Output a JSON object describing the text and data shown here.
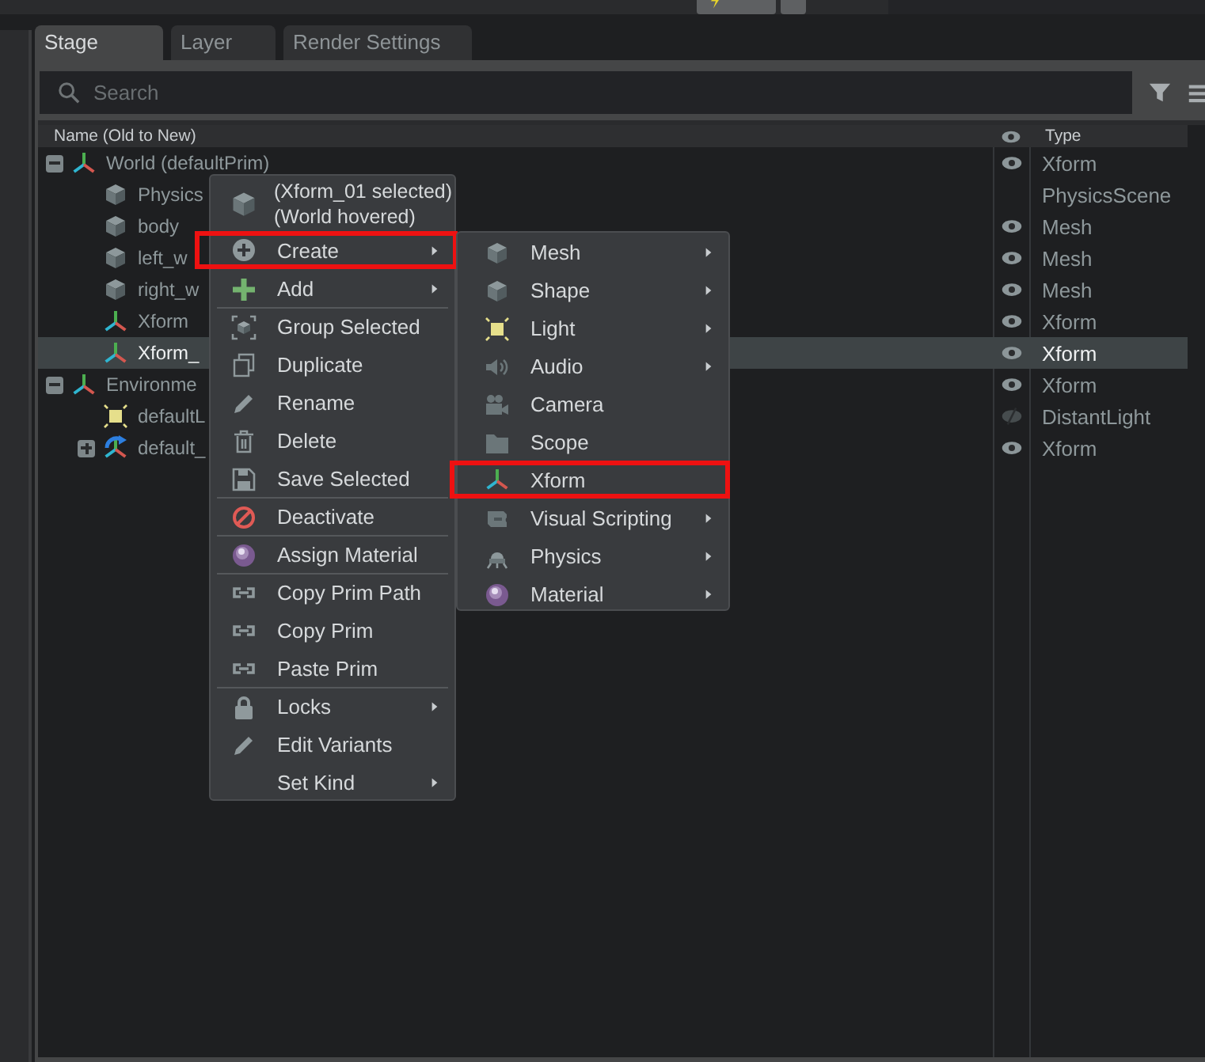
{
  "tabs": [
    {
      "label": "Stage",
      "selected": true
    },
    {
      "label": "Layer",
      "selected": false
    },
    {
      "label": "Render Settings",
      "selected": false
    }
  ],
  "search": {
    "placeholder": "Search"
  },
  "tree": {
    "columns": [
      "Name (Old to New)",
      "Type"
    ],
    "rows": [
      {
        "name": "World (defaultPrim)",
        "kind": "xform",
        "type": "Xform",
        "visible": true,
        "expanded": true,
        "selected": false,
        "children": [
          {
            "name": "Physics",
            "kind": "cube",
            "type": "PhysicsScene",
            "selected": false
          },
          {
            "name": "body",
            "kind": "cube",
            "type": "Mesh",
            "visible": true,
            "selected": false
          },
          {
            "name": "left_w",
            "kind": "cube",
            "type": "Mesh",
            "visible": true,
            "selected": false
          },
          {
            "name": "right_w",
            "kind": "cube",
            "type": "Mesh",
            "visible": true,
            "selected": false
          },
          {
            "name": "Xform",
            "kind": "xform",
            "type": "Xform",
            "visible": true,
            "selected": false
          },
          {
            "name": "Xform_",
            "kind": "xform",
            "type": "Xform",
            "visible": true,
            "selected": true
          }
        ]
      },
      {
        "name": "Environme",
        "kind": "xform",
        "type": "Xform",
        "visible": true,
        "expanded": true,
        "selected": false,
        "children": [
          {
            "name": "defaultL",
            "kind": "light",
            "type": "DistantLight",
            "visible": false,
            "selected": false
          },
          {
            "name": "default_",
            "kind": "xformlink",
            "type": "Xform",
            "visible": true,
            "expanded": false,
            "selected": false
          }
        ]
      }
    ]
  },
  "context_menu": {
    "header": [
      "(Xform_01 selected)",
      "(World hovered)"
    ],
    "items": [
      {
        "label": "Create",
        "kind": "create",
        "submenu": true,
        "separator": false,
        "outlined": true
      },
      {
        "label": "Add",
        "kind": "add",
        "submenu": true,
        "separator": false,
        "outlined": false
      },
      {
        "label": "Group Selected",
        "kind": "group",
        "submenu": false,
        "separator": true,
        "outlined": false
      },
      {
        "label": "Duplicate",
        "kind": "duplicate",
        "submenu": false,
        "separator": false,
        "outlined": false
      },
      {
        "label": "Rename",
        "kind": "rename",
        "submenu": false,
        "separator": false,
        "outlined": false
      },
      {
        "label": "Delete",
        "kind": "delete",
        "submenu": false,
        "separator": false,
        "outlined": false
      },
      {
        "label": "Save Selected",
        "kind": "save",
        "submenu": false,
        "separator": false,
        "outlined": false
      },
      {
        "label": "Deactivate",
        "kind": "deactivate",
        "submenu": false,
        "separator": true,
        "outlined": false
      },
      {
        "label": "Assign Material",
        "kind": "material",
        "submenu": false,
        "separator": true,
        "outlined": false
      },
      {
        "label": "Copy Prim Path",
        "kind": "copy",
        "submenu": false,
        "separator": true,
        "outlined": false
      },
      {
        "label": "Copy Prim",
        "kind": "copy",
        "submenu": false,
        "separator": false,
        "outlined": false
      },
      {
        "label": "Paste Prim",
        "kind": "copy",
        "submenu": false,
        "separator": false,
        "outlined": false
      },
      {
        "label": "Locks",
        "kind": "lock",
        "submenu": true,
        "separator": true,
        "outlined": false
      },
      {
        "label": "Edit Variants",
        "kind": "rename",
        "submenu": false,
        "separator": false,
        "outlined": false
      },
      {
        "label": "Set Kind",
        "kind": "plain",
        "submenu": true,
        "separator": false,
        "outlined": false
      }
    ]
  },
  "submenu": {
    "items": [
      {
        "label": "Mesh",
        "kind": "cube",
        "submenu": true,
        "outlined": false
      },
      {
        "label": "Shape",
        "kind": "cube",
        "submenu": true,
        "outlined": false
      },
      {
        "label": "Light",
        "kind": "light",
        "submenu": true,
        "outlined": false
      },
      {
        "label": "Audio",
        "kind": "audio",
        "submenu": true,
        "outlined": false
      },
      {
        "label": "Camera",
        "kind": "camera",
        "submenu": false,
        "outlined": false
      },
      {
        "label": "Scope",
        "kind": "scope",
        "submenu": false,
        "outlined": false
      },
      {
        "label": "Xform",
        "kind": "xform",
        "submenu": false,
        "outlined": true
      },
      {
        "label": "Visual Scripting",
        "kind": "script",
        "submenu": true,
        "outlined": false
      },
      {
        "label": "Physics",
        "kind": "physics",
        "submenu": true,
        "outlined": false
      },
      {
        "label": "Material",
        "kind": "material",
        "submenu": true,
        "outlined": false
      }
    ]
  }
}
